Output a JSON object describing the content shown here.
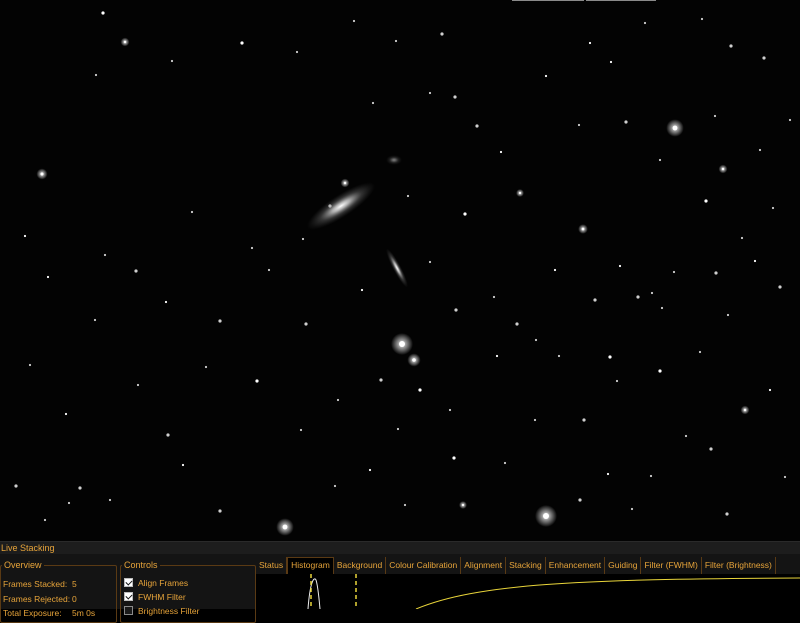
{
  "panel": {
    "title": "Live Stacking"
  },
  "overview": {
    "legend": "Overview",
    "frames_stacked_label": "Frames Stacked:",
    "frames_stacked_value": "5",
    "frames_rejected_label": "Frames Rejected:",
    "frames_rejected_value": "0",
    "total_exposure_label": "Total Exposure:",
    "total_exposure_value": "5m 0s"
  },
  "controls": {
    "legend": "Controls",
    "items": [
      {
        "label": "Align Frames",
        "checked": true
      },
      {
        "label": "FWHM Filter",
        "checked": true
      },
      {
        "label": "Brightness Filter",
        "checked": false
      }
    ]
  },
  "tabs": [
    {
      "label": "Status",
      "active": false
    },
    {
      "label": "Histogram",
      "active": true
    },
    {
      "label": "Background",
      "active": false
    },
    {
      "label": "Colour Calibration",
      "active": false
    },
    {
      "label": "Alignment",
      "active": false
    },
    {
      "label": "Stacking",
      "active": false
    },
    {
      "label": "Enhancement",
      "active": false
    },
    {
      "label": "Guiding",
      "active": false
    },
    {
      "label": "Filter (FWHM)",
      "active": false
    },
    {
      "label": "Filter (Brightness)",
      "active": false
    }
  ],
  "colors": {
    "accent": "#e7a43a",
    "histogram_curve": "#e9d53a",
    "panel_bg": "#141414"
  }
}
